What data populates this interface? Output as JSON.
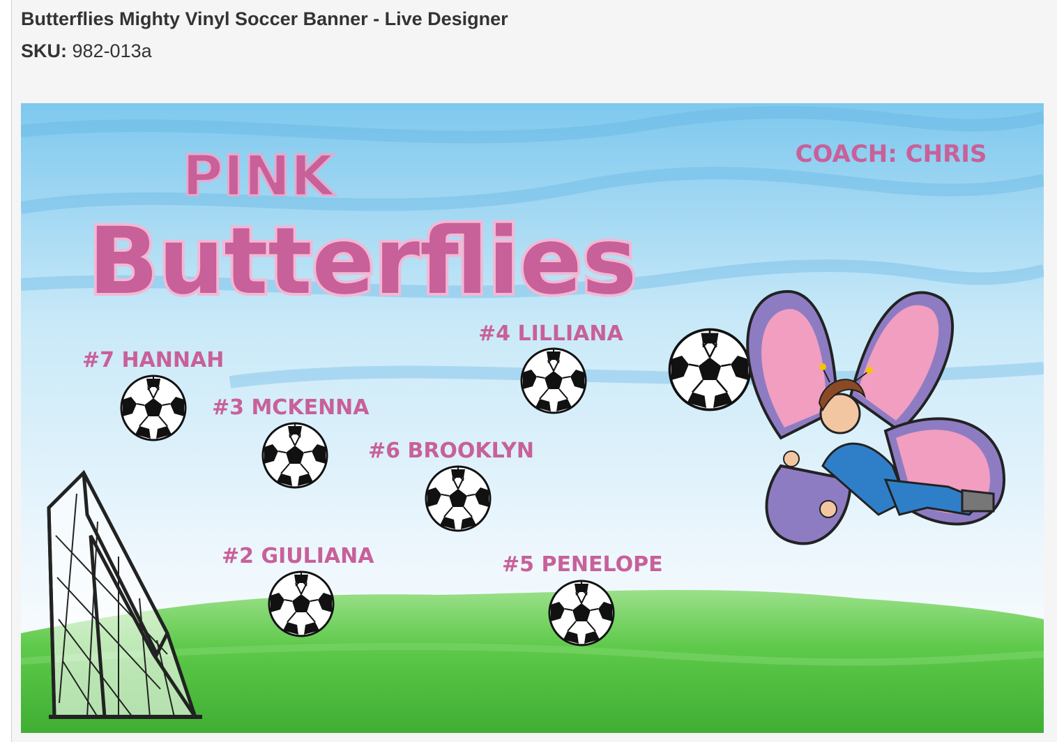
{
  "product": {
    "title": "Butterflies Mighty Vinyl Soccer Banner - Live Designer",
    "sku_label": "SKU:",
    "sku_value": "982-013a"
  },
  "banner": {
    "team_word1": "PINK",
    "team_word2": "Butterflies",
    "coach": "COACH: CHRIS",
    "players": [
      "#7 HANNAH",
      "#3 MCKENNA",
      "#4 LILLIANA",
      "#6 BROOKLYN",
      "#2 GIULIANA",
      "#5 PENELOPE"
    ],
    "text_color": "#c8609a",
    "sky_color": "#8fd0f0",
    "grass_color": "#5ec94a"
  }
}
